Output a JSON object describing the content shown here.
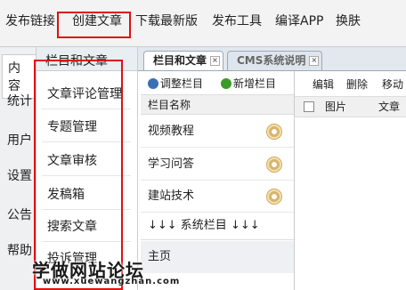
{
  "topnav": [
    "发布链接",
    "创建文章",
    "下载最新版",
    "发布工具",
    "编译APP",
    "换肤"
  ],
  "leftnav": [
    "内容",
    "统计",
    "用户",
    "设置",
    "公告",
    "帮助"
  ],
  "submenu": {
    "header": "栏目和文章",
    "items": [
      "文章评论管理",
      "专题管理",
      "文章审核",
      "发稿箱",
      "搜索文章",
      "投诉管理"
    ]
  },
  "tabs": [
    {
      "label": "栏目和文章",
      "close": "×"
    },
    {
      "label": "CMS系统说明",
      "close": "×"
    }
  ],
  "panel": {
    "adjust": "调整栏目",
    "add": "新增栏目",
    "col_header": "栏目名称",
    "rows": [
      "视频教程",
      "学习问答",
      "建站技术"
    ],
    "system_row": "↓↓↓ 系统栏目 ↓↓↓",
    "home_row": "主页"
  },
  "right": {
    "toolbar": [
      "编辑",
      "删除",
      "移动"
    ],
    "headers": [
      "图片",
      "文章"
    ]
  },
  "watermark": {
    "title": "学做网站论坛",
    "url": "www.xuewangzhan.com"
  },
  "colors": {
    "highlight": "#e01010",
    "add_icon": "#3a9a2a",
    "adjust_icon": "#3a6fb5"
  }
}
